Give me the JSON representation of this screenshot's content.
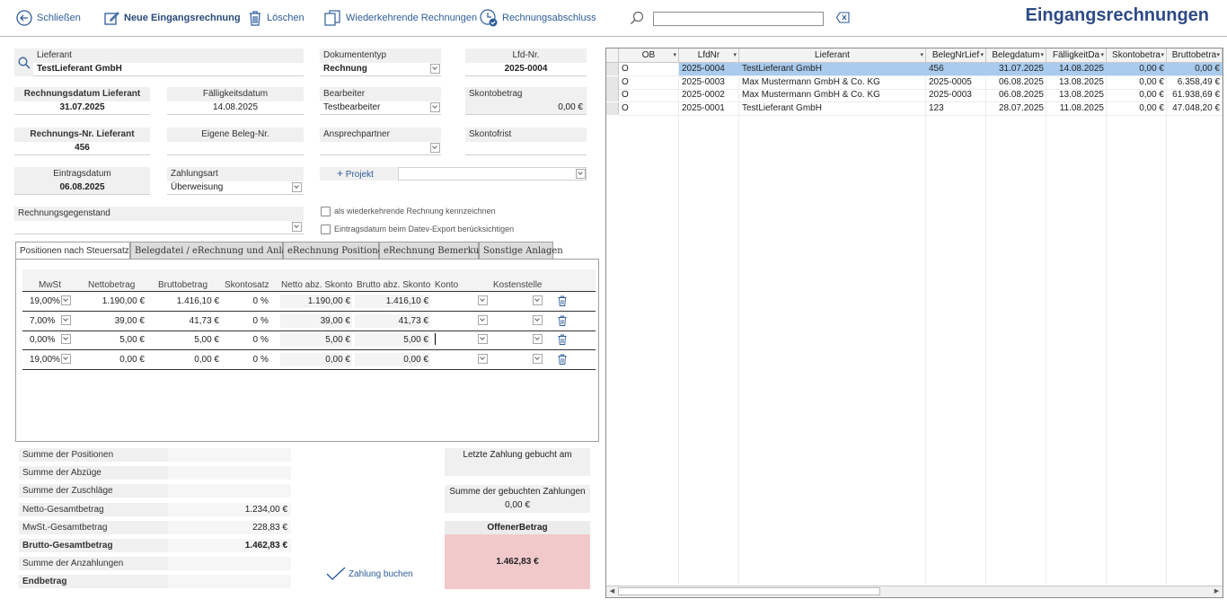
{
  "toolbar": {
    "close": "Schließen",
    "new": "Neue Eingangsrechnung",
    "delete": "Löschen",
    "recurring": "Wiederkehrende Rechnungen",
    "closing": "Rechnungsabschluss",
    "search_value": "",
    "app_title": "Eingangsrechnungen"
  },
  "form": {
    "supplier_label": "Lieferant",
    "supplier_value": "TestLieferant GmbH",
    "doctype_label": "Dokumententyp",
    "doctype_value": "Rechnung",
    "lfd_label": "Lfd-Nr.",
    "lfd_value": "2025-0004",
    "invdate_label": "Rechnungsdatum Lieferant",
    "invdate_value": "31.07.2025",
    "duedate_label": "Fälligkeitsdatum",
    "duedate_value": "14.08.2025",
    "editor_label": "Bearbeiter",
    "editor_value": "Testbearbeiter",
    "discount_label": "Skontobetrag",
    "discount_value": "0,00 €",
    "invno_label": "Rechnungs-Nr. Lieferant",
    "invno_value": "456",
    "ownno_label": "Eigene Beleg-Nr.",
    "ownno_value": "",
    "contact_label": "Ansprechpartner",
    "contact_value": "",
    "discountdue_label": "Skontofrist",
    "discountdue_value": "",
    "entrydate_label": "Eintragsdatum",
    "entrydate_value": "06.08.2025",
    "payment_label": "Zahlungsart",
    "payment_value": "Überweisung",
    "project_label": "Projekt",
    "subject_label": "Rechnungsgegenstand",
    "subject_value": "",
    "recurring_check": "als wiederkehrende Rechnung kennzeichnen",
    "datev_check": "Eintragsdatum beim Datev-Export berücksichtigen"
  },
  "tabs": [
    "Positionen nach Steuersatz",
    "Belegdatei / eRechnung und Anlagen",
    "eRechnung Positionen",
    "eRechnung Bemerkung",
    "Sonstige Anlagen"
  ],
  "positions": {
    "headers": [
      "MwSt",
      "Nettobetrag",
      "Bruttobetrag",
      "Skontosatz",
      "Netto abz. Skonto",
      "Brutto abz. Skonto",
      "Konto",
      "Kostenstelle"
    ],
    "percent_sign": "%",
    "rows": [
      {
        "vat": "19,00%",
        "net": "1.190,00 €",
        "gross": "1.416,10 €",
        "rate": "0",
        "net_d": "1.190,00 €",
        "gross_d": "1.416,10 €"
      },
      {
        "vat": "7,00%",
        "net": "39,00 €",
        "gross": "41,73 €",
        "rate": "0",
        "net_d": "39,00 €",
        "gross_d": "41,73 €"
      },
      {
        "vat": "0,00%",
        "net": "5,00 €",
        "gross": "5,00 €",
        "rate": "0",
        "net_d": "5,00 €",
        "gross_d": "5,00 €"
      },
      {
        "vat": "19,00%",
        "net": "0,00 €",
        "gross": "0,00 €",
        "rate": "0",
        "net_d": "0,00 €",
        "gross_d": "0,00 €"
      }
    ]
  },
  "summary": [
    {
      "label": "Summe der Positionen",
      "value": ""
    },
    {
      "label": "Summe der Abzüge",
      "value": ""
    },
    {
      "label": "Summe der Zuschläge",
      "value": ""
    },
    {
      "label": "Netto-Gesamtbetrag",
      "value": "1.234,00 €"
    },
    {
      "label": "MwSt.-Gesamtbetrag",
      "value": "228,83 €"
    },
    {
      "label": "Brutto-Gesamtbetrag",
      "value": "1.462,83 €"
    },
    {
      "label": "Summe der Anzahlungen",
      "value": ""
    },
    {
      "label": "Endbetrag",
      "value": ""
    }
  ],
  "payment": {
    "last_label": "Letzte Zahlung gebucht am",
    "last_value": "",
    "sum_label": "Summe der gebuchten Zahlungen",
    "sum_value": "0,00 €",
    "open_label": "OffenerBetrag",
    "open_value": "1.462,83 €",
    "book_button": "Zahlung buchen"
  },
  "list": {
    "headers": [
      "OB",
      "LfdNr",
      "Lieferant",
      "BelegNrLief",
      "Belegdatum",
      "FälligkeitDa",
      "Skontobetra",
      "Bruttobetra"
    ],
    "rows": [
      [
        "O",
        "2025-0004",
        "TestLieferant GmbH",
        "456",
        "31.07.2025",
        "14.08.2025",
        "0,00 €",
        "0,00 €"
      ],
      [
        "O",
        "2025-0003",
        "Max Mustermann GmbH & Co. KG",
        "2025-0005",
        "06.08.2025",
        "13.08.2025",
        "0,00 €",
        "6.358,49 €"
      ],
      [
        "O",
        "2025-0002",
        "Max Mustermann GmbH & Co. KG",
        "2025-0003",
        "06.08.2025",
        "13.08.2025",
        "0,00 €",
        "61.938,69 €"
      ],
      [
        "O",
        "2025-0001",
        "TestLieferant GmbH",
        "123",
        "28.07.2025",
        "11.08.2025",
        "0,00 €",
        "47.048,20 €"
      ]
    ]
  },
  "colors": {
    "accent": "#2f5d9a",
    "title": "#2e4b87",
    "selected_row": "#a9cbee",
    "open_amount_bg": "#f1c9cb"
  }
}
